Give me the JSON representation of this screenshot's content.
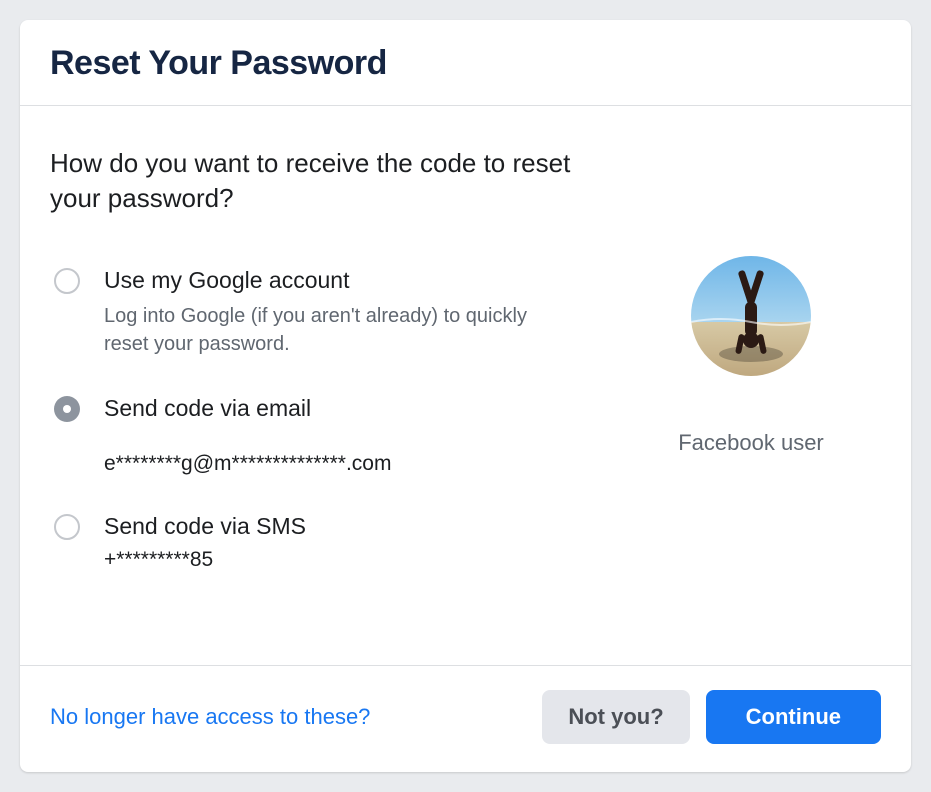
{
  "header": {
    "title": "Reset Your Password"
  },
  "body": {
    "prompt": "How do you want to receive the code to reset your password?",
    "options": [
      {
        "id": "google",
        "title": "Use my Google account",
        "subtitle": "Log into Google (if you aren't already) to quickly reset your password.",
        "selected": false
      },
      {
        "id": "email",
        "title": "Send code via email",
        "value": "e********g@m**************.com",
        "selected": true
      },
      {
        "id": "sms",
        "title": "Send code via SMS",
        "value": "+*********85",
        "selected": false
      }
    ],
    "user_label": "Facebook user"
  },
  "footer": {
    "no_access_link": "No longer have access to these?",
    "not_you_button": "Not you?",
    "continue_button": "Continue"
  },
  "colors": {
    "primary": "#1877f2",
    "secondary_bg": "#e4e6eb",
    "border": "#dddfe2",
    "muted": "#606770"
  }
}
